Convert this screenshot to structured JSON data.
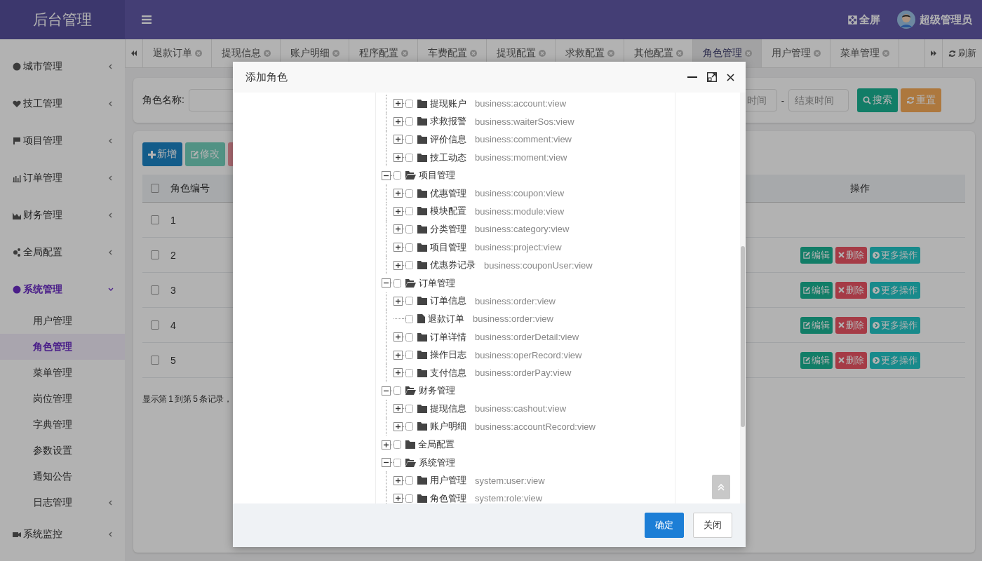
{
  "header": {
    "brand": "后台管理",
    "fullscreen": "全屏",
    "user": "超级管理员"
  },
  "sidebar": [
    {
      "label": "城市管理",
      "expanded": false,
      "selected": false
    },
    {
      "label": "技工管理",
      "expanded": false,
      "selected": false
    },
    {
      "label": "项目管理",
      "expanded": false,
      "selected": false
    },
    {
      "label": "订单管理",
      "expanded": false,
      "selected": false
    },
    {
      "label": "财务管理",
      "expanded": false,
      "selected": false
    },
    {
      "label": "全局配置",
      "expanded": false,
      "selected": false
    },
    {
      "label": "系统管理",
      "expanded": true,
      "selected": true,
      "children": [
        {
          "label": "用户管理",
          "kind": "link",
          "selected": false
        },
        {
          "label": "角色管理",
          "kind": "link",
          "selected": true
        },
        {
          "label": "菜单管理",
          "kind": "link",
          "selected": false
        },
        {
          "label": "岗位管理",
          "kind": "link",
          "selected": false
        },
        {
          "label": "字典管理",
          "kind": "link",
          "selected": false
        },
        {
          "label": "参数设置",
          "kind": "link",
          "selected": false
        },
        {
          "label": "通知公告",
          "kind": "link",
          "selected": false
        },
        {
          "label": "日志管理",
          "kind": "group",
          "selected": false
        }
      ]
    },
    {
      "label": "系统监控",
      "expanded": false,
      "selected": false
    }
  ],
  "tabs": [
    {
      "label": "退款订单",
      "selected": false
    },
    {
      "label": "提现信息",
      "selected": false
    },
    {
      "label": "账户明细",
      "selected": false
    },
    {
      "label": "程序配置",
      "selected": false
    },
    {
      "label": "车费配置",
      "selected": false
    },
    {
      "label": "提现配置",
      "selected": false
    },
    {
      "label": "求救配置",
      "selected": false
    },
    {
      "label": "其他配置",
      "selected": false
    },
    {
      "label": "角色管理",
      "selected": true
    },
    {
      "label": "用户管理",
      "selected": false
    },
    {
      "label": "菜单管理",
      "selected": false
    }
  ],
  "refresh": "刷新",
  "search": {
    "label": "角色名称:",
    "start_placeholder": "时间",
    "separator": "-",
    "end_placeholder": "结束时间",
    "buttons": [
      {
        "label": "搜索",
        "kind": "search"
      },
      {
        "label": "重置",
        "kind": "reset"
      }
    ]
  },
  "toolbar": [
    {
      "label": "新增",
      "kind": "add",
      "disabled": false
    },
    {
      "label": "修改",
      "kind": "edit",
      "disabled": true
    },
    {
      "kind": "remove",
      "disabled": true
    }
  ],
  "table": {
    "header_checked": false,
    "columns": [
      "角色编号",
      "操作"
    ],
    "rows": [
      {
        "id": "1",
        "checked": false,
        "actions": []
      },
      {
        "id": "2",
        "checked": false,
        "actions": [
          {
            "label": "编辑",
            "kind": "edit"
          },
          {
            "label": "删除",
            "kind": "delete"
          },
          {
            "label": "更多操作",
            "kind": "more"
          }
        ]
      },
      {
        "id": "3",
        "checked": false,
        "actions": [
          {
            "label": "编辑",
            "kind": "edit"
          },
          {
            "label": "删除",
            "kind": "delete"
          },
          {
            "label": "更多操作",
            "kind": "more"
          }
        ]
      },
      {
        "id": "4",
        "checked": false,
        "actions": [
          {
            "label": "编辑",
            "kind": "edit"
          },
          {
            "label": "删除",
            "kind": "delete"
          },
          {
            "label": "更多操作",
            "kind": "more"
          }
        ]
      },
      {
        "id": "5",
        "checked": false,
        "actions": [
          {
            "label": "编辑",
            "kind": "edit"
          },
          {
            "label": "删除",
            "kind": "delete"
          },
          {
            "label": "更多操作",
            "kind": "more"
          }
        ]
      }
    ],
    "footer": "显示第 1 到第 5 条记录，"
  },
  "modal": {
    "title": "添加角色",
    "tree": [
      {
        "children": [
          {
            "label": "提现账户",
            "perm": "business:account:view",
            "expanded": false,
            "checked": false
          },
          {
            "label": "求救报警",
            "perm": "business:waiterSos:view",
            "expanded": false,
            "checked": false
          },
          {
            "label": "评价信息",
            "perm": "business:comment:view",
            "expanded": false,
            "checked": false
          },
          {
            "label": "技工动态",
            "perm": "business:moment:view",
            "expanded": false,
            "checked": false
          }
        ]
      },
      {
        "label": "项目管理",
        "expanded": true,
        "checked": false,
        "children": [
          {
            "label": "优惠管理",
            "perm": "business:coupon:view",
            "expanded": false,
            "checked": false
          },
          {
            "label": "模块配置",
            "perm": "business:module:view",
            "expanded": false,
            "checked": false
          },
          {
            "label": "分类管理",
            "perm": "business:category:view",
            "expanded": false,
            "checked": false
          },
          {
            "label": "项目管理",
            "perm": "business:project:view",
            "expanded": false,
            "checked": false
          },
          {
            "label": "优惠券记录",
            "perm": "business:couponUser:view",
            "expanded": false,
            "checked": false
          }
        ]
      },
      {
        "label": "订单管理",
        "expanded": true,
        "checked": false,
        "children": [
          {
            "label": "订单信息",
            "perm": "business:order:view",
            "expanded": false,
            "checked": false
          },
          {
            "label": "退款订单",
            "perm": "business:order:view",
            "checked": false
          },
          {
            "label": "订单详情",
            "perm": "business:orderDetail:view",
            "expanded": false,
            "checked": false
          },
          {
            "label": "操作日志",
            "perm": "business:operRecord:view",
            "expanded": false,
            "checked": false
          },
          {
            "label": "支付信息",
            "perm": "business:orderPay:view",
            "expanded": false,
            "checked": false
          }
        ]
      },
      {
        "label": "财务管理",
        "expanded": true,
        "checked": false,
        "children": [
          {
            "label": "提现信息",
            "perm": "business:cashout:view",
            "expanded": false,
            "checked": false
          },
          {
            "label": "账户明细",
            "perm": "business:accountRecord:view",
            "expanded": false,
            "checked": false
          }
        ]
      },
      {
        "label": "全局配置",
        "expanded": false,
        "checked": false
      },
      {
        "label": "系统管理",
        "expanded": true,
        "checked": false,
        "children": [
          {
            "label": "用户管理",
            "perm": "system:user:view",
            "expanded": false,
            "checked": false
          },
          {
            "label": "角色管理",
            "perm": "system:role:view",
            "expanded": false,
            "checked": false
          }
        ]
      }
    ],
    "buttons": [
      {
        "label": "确定",
        "kind": "primary"
      },
      {
        "label": "关闭",
        "kind": "default"
      }
    ]
  }
}
